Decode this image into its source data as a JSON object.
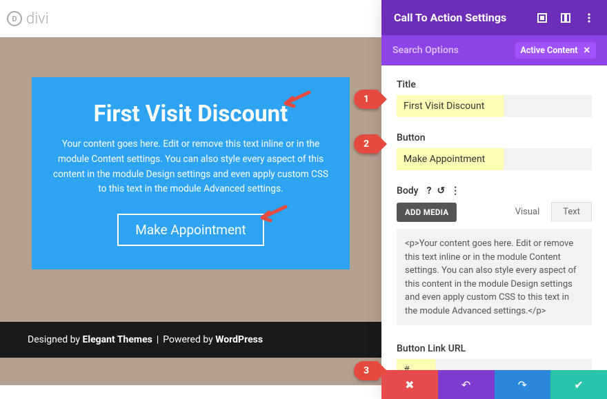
{
  "logo": {
    "text": "divi",
    "mark": "D"
  },
  "preview": {
    "ctaTitle": "First Visit Discount",
    "ctaBody": "Your content goes here. Edit or remove this text inline or in the module Content settings. You can also style every aspect of this content in the module Design settings and even apply custom CSS to this text in the module Advanced settings.",
    "ctaButton": "Make Appointment"
  },
  "footer": {
    "designedBy": "Designed by",
    "designer": "Elegant Themes",
    "poweredBy": "Powered by",
    "platform": "WordPress"
  },
  "panel": {
    "title": "Call To Action Settings",
    "searchPlaceholder": "Search Options",
    "activeTag": "Active Content",
    "fields": {
      "titleLabel": "Title",
      "titleValue": "First Visit Discount",
      "buttonLabel": "Button",
      "buttonValue": "Make Appointment",
      "bodyLabel": "Body",
      "addMedia": "ADD MEDIA",
      "tabVisual": "Visual",
      "tabText": "Text",
      "bodyValue": "<p>Your content goes here. Edit or remove this text inline or in the module Content settings. You can also style every aspect of this content in the module Design settings and even apply custom CSS to this text in the module Advanced settings.</p>",
      "urlLabel": "Button Link URL",
      "urlValue": "#"
    }
  },
  "badges": {
    "n1": "1",
    "n2": "2",
    "n3": "3"
  }
}
